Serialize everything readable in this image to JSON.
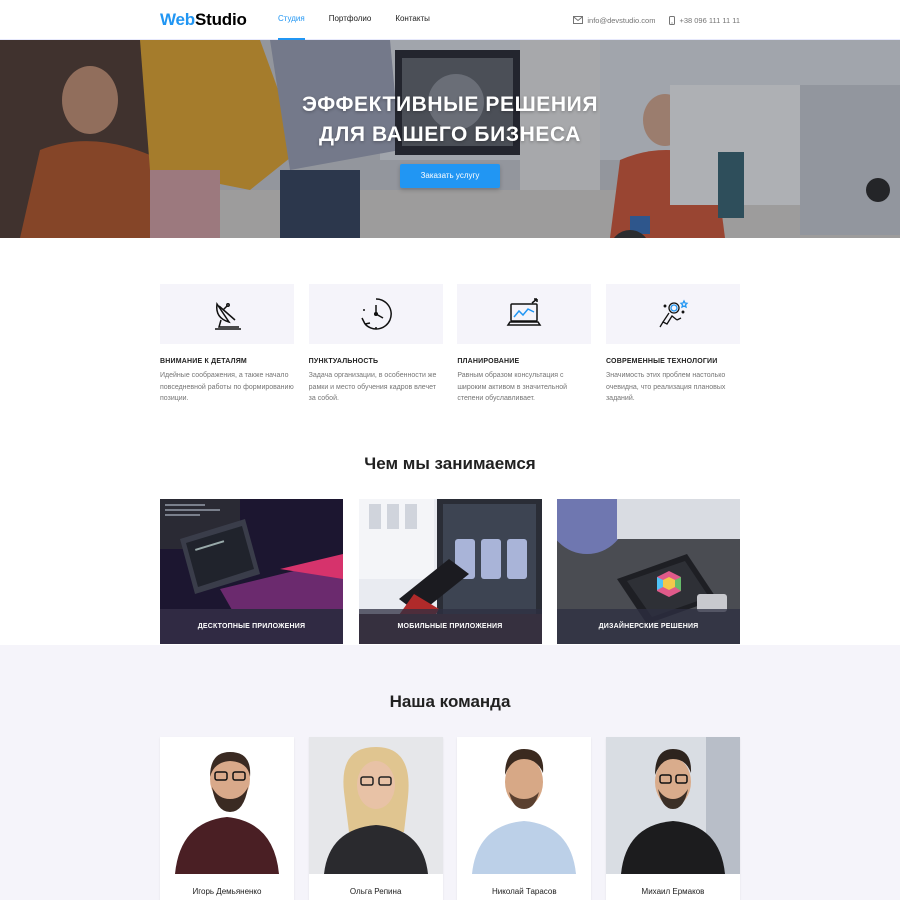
{
  "header": {
    "logo_primary": "Web",
    "logo_secondary": "Studio",
    "nav": [
      {
        "label": "Студия",
        "active": true
      },
      {
        "label": "Портфолио",
        "active": false
      },
      {
        "label": "Контакты",
        "active": false
      }
    ],
    "email": "info@devstudio.com",
    "phone": "+38 096 111 11 11",
    "icons": {
      "email": "mail-icon",
      "phone": "phone-icon"
    }
  },
  "hero": {
    "title_line1": "ЭФФЕКТИВНЫЕ РЕШЕНИЯ",
    "title_line2": "ДЛЯ ВАШЕГО БИЗНЕСА",
    "button": "Заказать услугу"
  },
  "features": [
    {
      "icon": "satellite-dish-icon",
      "title": "ВНИМАНИЕ К ДЕТАЛЯМ",
      "text": "Идейные соображения, а также начало повседневной работы по формированию позиции."
    },
    {
      "icon": "clock-icon",
      "title": "ПУНКТУАЛЬНОСТЬ",
      "text": "Задача организации, в особенности же рамки и место обучения кадров влечет за собой."
    },
    {
      "icon": "laptop-chart-icon",
      "title": "ПЛАНИРОВАНИЕ",
      "text": "Равным образом консультация с широким активом в значительной степени обуславливает."
    },
    {
      "icon": "astronaut-icon",
      "title": "СОВРЕМЕННЫЕ ТЕХНОЛОГИИ",
      "text": "Значимость этих проблем настолько очевидна, что реализация плановых заданий."
    }
  ],
  "services": {
    "title": "Чем мы занимаемся",
    "items": [
      {
        "label": "ДЕСКТОПНЫЕ ПРИЛОЖЕНИЯ"
      },
      {
        "label": "МОБИЛЬНЫЕ ПРИЛОЖЕНИЯ"
      },
      {
        "label": "ДИЗАЙНЕРСКИЕ РЕШЕНИЯ"
      }
    ]
  },
  "team": {
    "title": "Наша команда",
    "members": [
      {
        "name": "Игорь Демьяненко"
      },
      {
        "name": "Ольга Репина"
      },
      {
        "name": "Николай Тарасов"
      },
      {
        "name": "Михаил Ермаков"
      }
    ]
  },
  "colors": {
    "accent": "#2196f3",
    "text": "#212121",
    "muted": "#757575",
    "section_bg": "#f5f4fa"
  }
}
